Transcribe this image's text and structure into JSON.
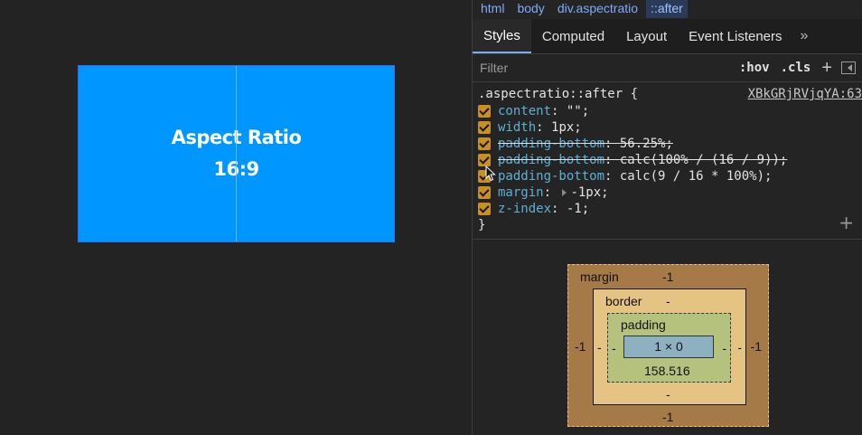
{
  "page": {
    "demo_line1": "Aspect Ratio",
    "demo_line2": "16:9",
    "demo_color": "#0096ff"
  },
  "breadcrumbs": [
    "html",
    "body",
    "div.aspectratio",
    "::after"
  ],
  "tabs": {
    "styles": "Styles",
    "computed": "Computed",
    "layout": "Layout",
    "event_listeners": "Event Listeners",
    "more": "»"
  },
  "filterbar": {
    "placeholder": "Filter",
    "hov": ":hov",
    "cls": ".cls",
    "add": "+"
  },
  "rule": {
    "selector": ".aspectratio::after {",
    "source": "XBkGRjRVjqYA:63",
    "declarations": [
      {
        "prop": "content",
        "value": "\"\";",
        "struck": false
      },
      {
        "prop": "width",
        "value": "1px;",
        "struck": false
      },
      {
        "prop": "padding-bottom",
        "value": "56.25%;",
        "struck": true
      },
      {
        "prop": "padding-bottom",
        "value": "calc(100% / (16 / 9));",
        "struck": true
      },
      {
        "prop": "padding-bottom",
        "value": "calc(9 / 16 * 100%);",
        "struck": false
      },
      {
        "prop": "margin",
        "value": "-1px;",
        "struck": false,
        "expand": true
      },
      {
        "prop": "z-index",
        "value": "-1;",
        "struck": false
      }
    ],
    "close": "}",
    "add": "+"
  },
  "boxmodel": {
    "margin_label": "margin",
    "margin_top": "-1",
    "margin_right": "-1",
    "margin_bottom": "-1",
    "margin_left": "-1",
    "border_label": "border",
    "border_top": "-",
    "border_right": "-",
    "border_bottom": "-",
    "border_left": "-",
    "padding_label": "padding",
    "padding_right": "-",
    "padding_bottom": "158.516",
    "padding_left": "-",
    "content": "1 × 0"
  },
  "colors": {
    "margin": "#a67a46",
    "border": "#e5c483",
    "padding": "#b5c27e",
    "content": "#8db1c1",
    "checkbox": "#c98f27",
    "property": "#5db0d7"
  }
}
